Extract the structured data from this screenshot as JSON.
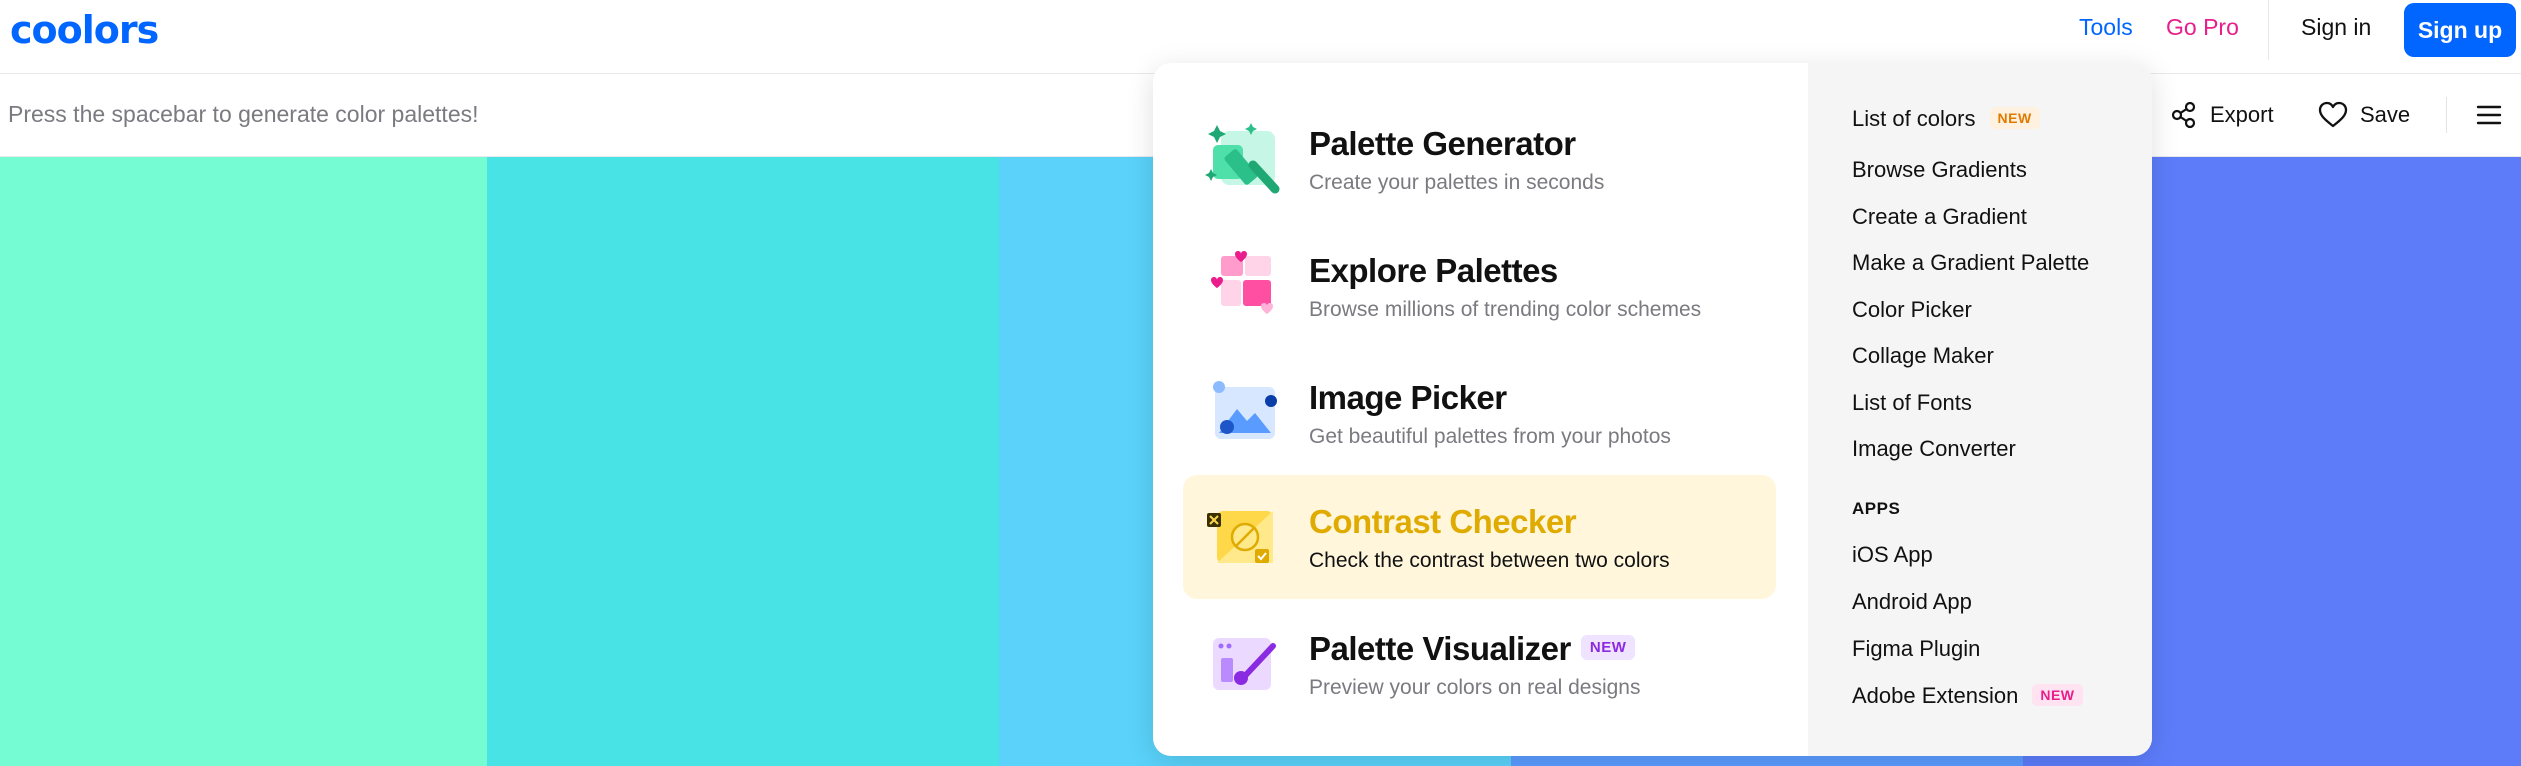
{
  "header": {
    "logo": "coolors",
    "tools_label": "Tools",
    "gopro_label": "Go Pro",
    "signin_label": "Sign in",
    "signup_label": "Sign up"
  },
  "toolbar": {
    "hint": "Press the spacebar to generate color palettes!",
    "export_label": "Export",
    "save_label": "Save"
  },
  "palette": {
    "colors": [
      "#76fcd3",
      "#47e3e5",
      "#5ad2fa",
      "#5a9bff",
      "#5c7cfa"
    ]
  },
  "dropdown": {
    "tools": [
      {
        "title": "Palette Generator",
        "desc": "Create your palettes in seconds",
        "icon": "palette-generator-icon"
      },
      {
        "title": "Explore Palettes",
        "desc": "Browse millions of trending color schemes",
        "icon": "explore-palettes-icon"
      },
      {
        "title": "Image Picker",
        "desc": "Get beautiful palettes from your photos",
        "icon": "image-picker-icon"
      },
      {
        "title": "Contrast Checker",
        "desc": "Check the contrast between two colors",
        "icon": "contrast-checker-icon",
        "active": true
      },
      {
        "title": "Palette Visualizer",
        "desc": "Preview your colors on real designs",
        "icon": "palette-visualizer-icon",
        "badge": "NEW"
      }
    ],
    "links": [
      {
        "label": "List of colors",
        "badge": "NEW"
      },
      {
        "label": "Browse Gradients"
      },
      {
        "label": "Create a Gradient"
      },
      {
        "label": "Make a Gradient Palette"
      },
      {
        "label": "Color Picker"
      },
      {
        "label": "Collage Maker"
      },
      {
        "label": "List of Fonts"
      },
      {
        "label": "Image Converter"
      }
    ],
    "apps_heading": "APPS",
    "apps": [
      {
        "label": "iOS App"
      },
      {
        "label": "Android App"
      },
      {
        "label": "Figma Plugin"
      },
      {
        "label": "Adobe Extension",
        "badge": "NEW"
      }
    ]
  }
}
